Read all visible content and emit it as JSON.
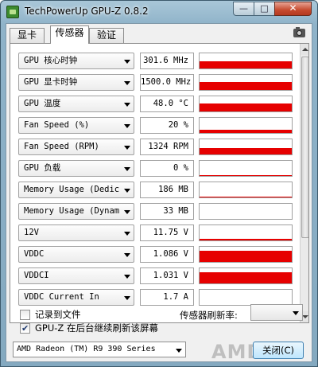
{
  "window": {
    "title": "TechPowerUp GPU-Z 0.8.2",
    "minimize_label": "—",
    "maximize_label": "□",
    "close_label": "✕"
  },
  "tabs": [
    {
      "label": "显卡"
    },
    {
      "label": "传感器",
      "active": true
    },
    {
      "label": "验证"
    }
  ],
  "sensors": [
    {
      "label": "GPU 核心时钟",
      "value": "301.6 MHz",
      "level": 0.45
    },
    {
      "label": "GPU 显卡时钟",
      "value": "1500.0 MHz",
      "level": 0.55
    },
    {
      "label": "GPU 温度",
      "value": "48.0 °C",
      "level": 0.5
    },
    {
      "label": "Fan Speed (%)",
      "value": "20 %",
      "level": 0.2
    },
    {
      "label": "Fan Speed (RPM)",
      "value": "1324 RPM",
      "level": 0.4
    },
    {
      "label": "GPU 负载",
      "value": "0 %",
      "level": 0.04
    },
    {
      "label": "Memory Usage (Dedicated)",
      "value": "186 MB",
      "level": 0.04
    },
    {
      "label": "Memory Usage (Dynamic)",
      "value": "33 MB",
      "level": 0.0
    },
    {
      "label": "12V",
      "value": "11.75 V",
      "level": 0.1
    },
    {
      "label": "VDDC",
      "value": "1.086 V",
      "level": 0.75
    },
    {
      "label": "VDDCI",
      "value": "1.031 V",
      "level": 0.72
    },
    {
      "label": "VDDC Current In",
      "value": "1.7 A",
      "level": 0.0
    }
  ],
  "options": {
    "log_to_file": {
      "label": "记录到文件",
      "checked": false
    },
    "background_refresh": {
      "label": "GPU-Z 在后台继续刷新该屏幕",
      "checked": true
    },
    "refresh_rate_label": "传感器刷新率:",
    "refresh_rate_value": ""
  },
  "gpu_selector": {
    "value": "AMD Radeon (TM) R9 390 Series"
  },
  "logo_text": "AMD",
  "close_button": {
    "label": "关闭(C)"
  },
  "colors": {
    "graph_fill": "#e60000",
    "window_frame": "#8fb3c9"
  }
}
